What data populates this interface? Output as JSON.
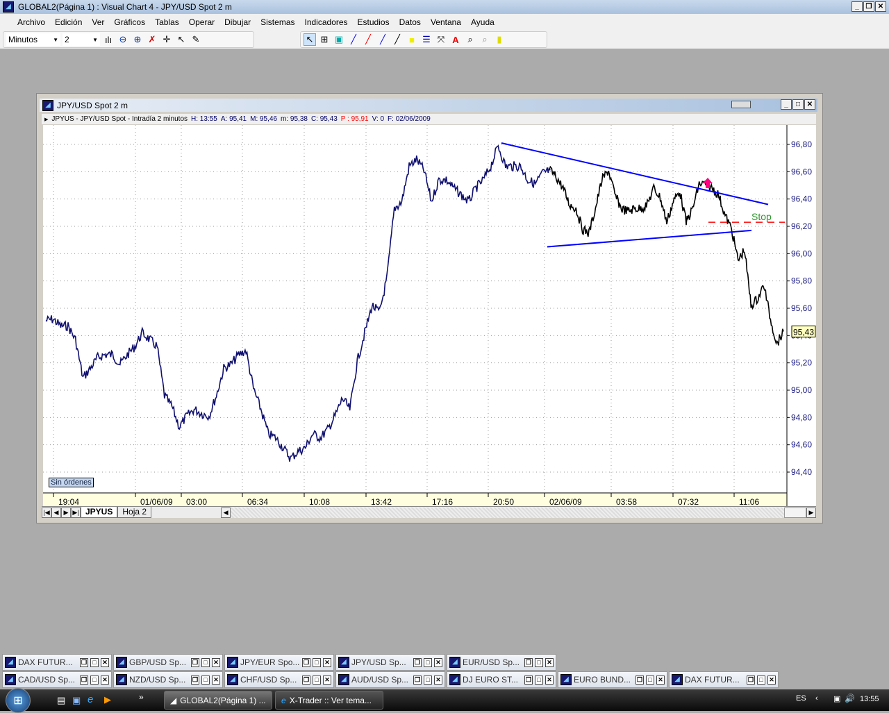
{
  "app": {
    "title": "GLOBAL2(Página 1) : Visual Chart 4 - JPY/USD Spot 2 m"
  },
  "menu": [
    "Archivo",
    "Edición",
    "Ver",
    "Gráficos",
    "Tablas",
    "Operar",
    "Dibujar",
    "Sistemas",
    "Indicadores",
    "Estudios",
    "Datos",
    "Ventana",
    "Ayuda"
  ],
  "toolbar": {
    "period_unit": "Minutos",
    "period_value": "2"
  },
  "chart_window": {
    "title": "JPY/USD Spot 2 m",
    "info": {
      "symbol": "JPYUS - JPY/USD Spot - Intradía 2 minutos",
      "h": "H: 13:55",
      "a": "A: 95,41",
      "m_high": "M: 95,46",
      "m_low": "m: 95,38",
      "c": "C: 95,43",
      "p": "P : 95,91",
      "v": "V: 0",
      "f": "F: 02/06/2009"
    },
    "orders_label": "Sin órdenes",
    "sheets": [
      "JPYUS",
      "Hoja 2"
    ]
  },
  "chart_data": {
    "type": "line",
    "title": "JPY/USD Spot 2 m",
    "ylim": [
      94.3,
      96.95
    ],
    "yticks": [
      "96,80",
      "96,60",
      "96,40",
      "96,20",
      "96,00",
      "95,80",
      "95,60",
      "95,40",
      "95,20",
      "95,00",
      "94,80",
      "94,60",
      "94,40"
    ],
    "ytick_values": [
      96.8,
      96.6,
      96.4,
      96.2,
      96.0,
      95.8,
      95.6,
      95.4,
      95.2,
      95.0,
      94.8,
      94.6,
      94.4
    ],
    "xticks": [
      "19:04",
      "01/06/09",
      "03:00",
      "06:34",
      "10:08",
      "13:42",
      "17:16",
      "20:50",
      "02/06/09",
      "03:58",
      "07:32",
      "11:06"
    ],
    "last_price_label": "95,43",
    "series": [
      {
        "name": "01/06/09",
        "color": "#101070",
        "values": [
          95.51,
          95.52,
          95.47,
          95.47,
          95.37,
          95.09,
          95.16,
          95.24,
          95.26,
          95.26,
          95.19,
          95.26,
          95.32,
          95.42,
          95.37,
          95.32,
          94.96,
          94.88,
          94.73,
          94.81,
          94.86,
          94.83,
          94.81,
          94.96,
          95.16,
          95.19,
          95.26,
          95.29,
          95.01,
          94.86,
          94.68,
          94.65,
          94.58,
          94.5,
          94.55,
          94.58,
          94.68,
          94.65,
          94.71,
          94.81,
          94.94,
          94.86,
          95.21,
          95.42,
          95.62,
          95.57,
          95.82,
          96.33,
          96.38,
          96.64,
          96.69,
          96.61,
          96.38,
          96.54,
          96.54,
          96.48,
          96.43,
          96.38,
          96.48,
          96.54,
          96.64,
          96.79,
          96.64,
          96.64,
          96.64,
          96.54,
          96.51,
          96.59,
          96.61
        ]
      },
      {
        "name": "02/06/09",
        "color": "#000000",
        "values": [
          96.61,
          96.56,
          96.48,
          96.36,
          96.33,
          96.18,
          96.15,
          96.33,
          96.54,
          96.61,
          96.43,
          96.33,
          96.31,
          96.33,
          96.33,
          96.36,
          96.48,
          96.41,
          96.23,
          96.38,
          96.46,
          96.23,
          96.33,
          96.51,
          96.51,
          96.48,
          96.43,
          96.28,
          96.18,
          95.95,
          96.03,
          95.62,
          95.67,
          95.77,
          95.52,
          95.34,
          95.43
        ]
      }
    ],
    "annotations": {
      "upper_trendline": [
        96.81,
        96.36
      ],
      "lower_trendline": [
        96.05,
        96.17
      ],
      "stop_price": 96.23,
      "stop_label": "Stop",
      "trendline_color": "#0000ff",
      "stop_color": "#ff0000",
      "arrow_color": "#ff0080"
    }
  },
  "minimized_windows": {
    "row1": [
      "DAX FUTUR...",
      "GBP/USD Sp...",
      "JPY/EUR Spo...",
      "JPY/USD Sp...",
      "EUR/USD Sp..."
    ],
    "row2": [
      "CAD/USD Sp...",
      "NZD/USD Sp...",
      "CHF/USD Sp...",
      "AUD/USD Sp...",
      "DJ EURO ST...",
      "EURO BUND...",
      "DAX FUTUR..."
    ]
  },
  "taskbar": {
    "tasks": [
      "GLOBAL2(Página 1) ...",
      "X-Trader :: Ver tema..."
    ],
    "lang": "ES",
    "clock": "13:55"
  }
}
